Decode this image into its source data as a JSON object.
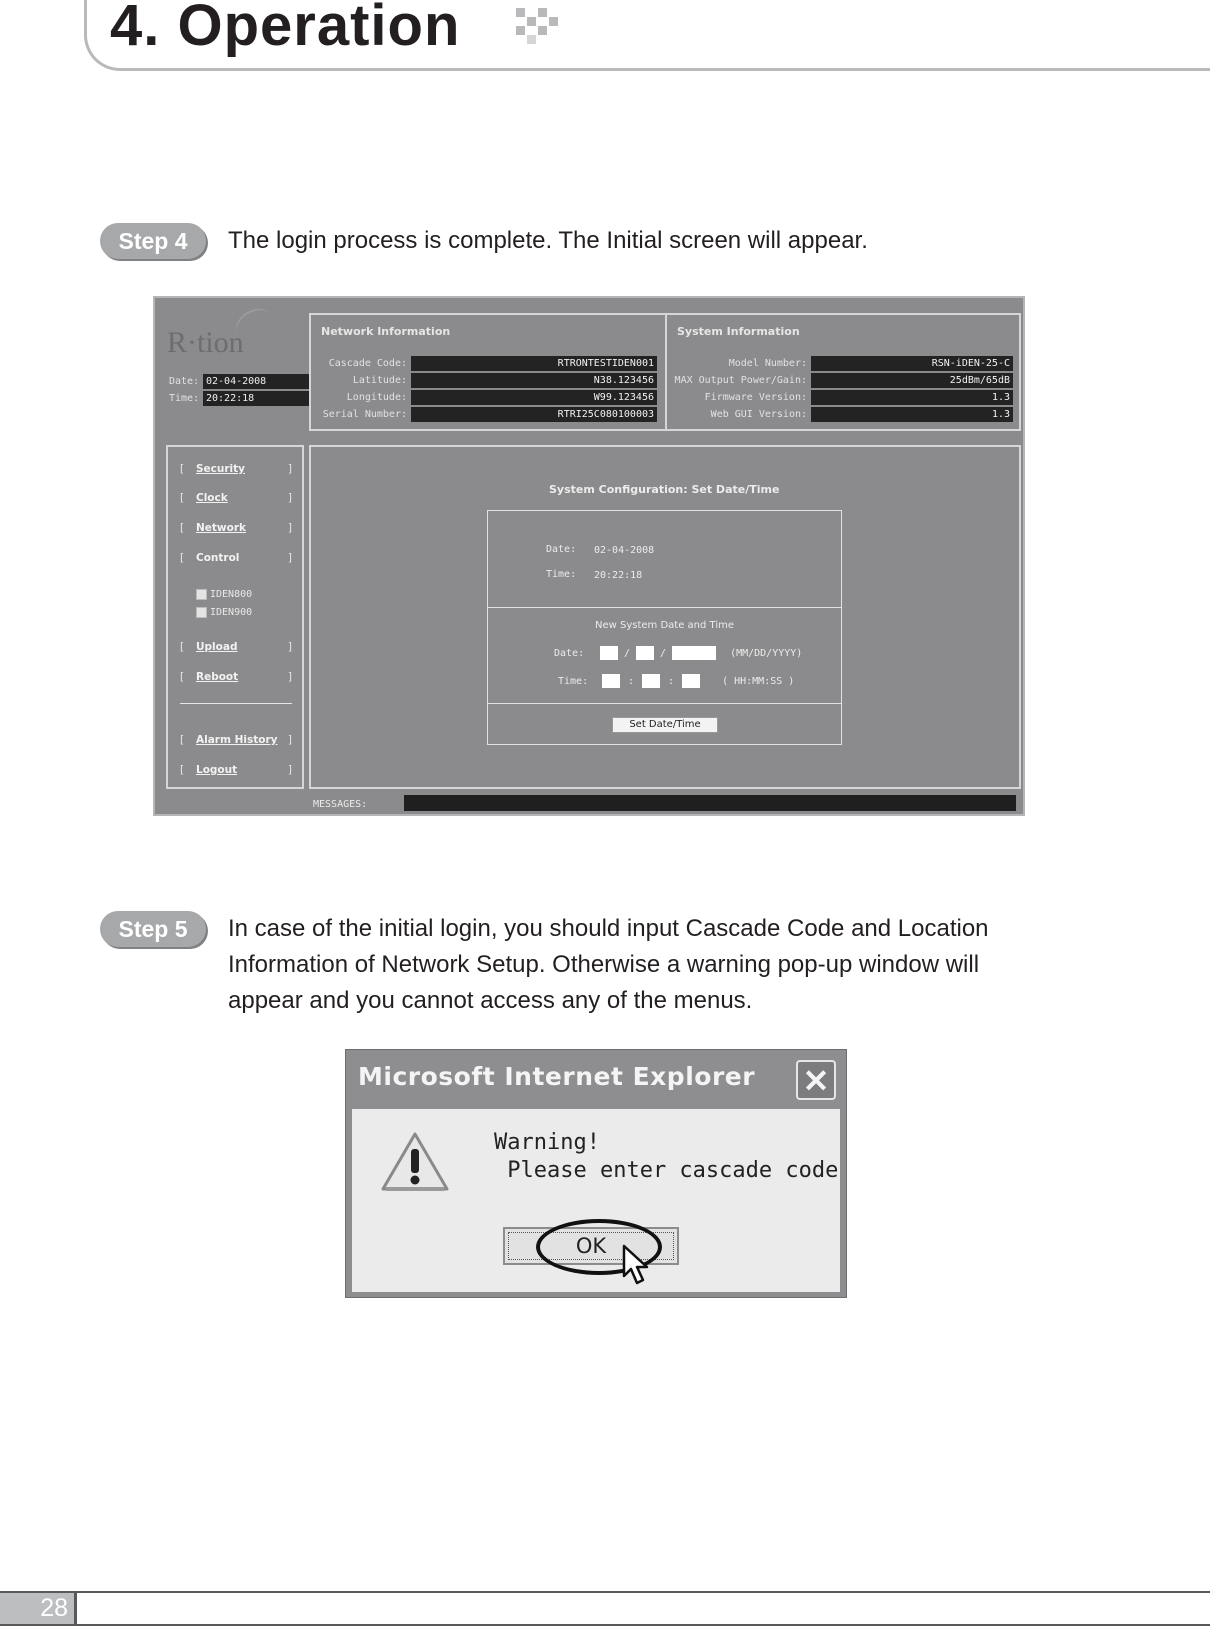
{
  "header": {
    "title": "4. Operation"
  },
  "steps": [
    {
      "badge": "Step 4",
      "text": "The login process is complete. The Initial screen will appear."
    },
    {
      "badge": "Step 5",
      "lines": [
        "In case of the initial login, you should input Cascade Code and Location",
        "Information of Network Setup. Otherwise a warning pop-up window will",
        "appear and you cannot access any of the menus."
      ]
    }
  ],
  "app": {
    "logo": "R·tion",
    "date_label": "Date:",
    "date_value": "02-04-2008",
    "time_label": "Time:",
    "time_value": "20:22:18",
    "network": {
      "title": "Network Information",
      "rows": [
        {
          "label": "Cascade Code:",
          "value": "RTRONTESTIDEN001"
        },
        {
          "label": "Latitude:",
          "value": "N38.123456"
        },
        {
          "label": "Longitude:",
          "value": "W99.123456"
        },
        {
          "label": "Serial Number:",
          "value": "RTRI25C080100003"
        }
      ]
    },
    "system": {
      "title": "System Information",
      "rows": [
        {
          "label": "Model Number:",
          "value": "RSN-iDEN-25-C"
        },
        {
          "label": "MAX Output Power/Gain:",
          "value": "25dBm/65dB"
        },
        {
          "label": "Firmware Version:",
          "value": "1.3"
        },
        {
          "label": "Web GUI Version:",
          "value": "1.3"
        }
      ]
    },
    "nav": {
      "items": [
        {
          "label": "Security"
        },
        {
          "label": "Clock"
        },
        {
          "label": "Network"
        },
        {
          "label": "Control"
        },
        {
          "label": "Upload"
        },
        {
          "label": "Reboot"
        },
        {
          "label": "Alarm History"
        },
        {
          "label": "Logout"
        }
      ],
      "checkboxes": [
        {
          "label": "IDEN800",
          "checked": false
        },
        {
          "label": "IDEN900",
          "checked": false
        }
      ],
      "bracket_l": "[",
      "bracket_r": "]"
    },
    "config": {
      "title": "System Configuration: Set Date/Time",
      "current_date_label": "Date:",
      "current_date": "02-04-2008",
      "current_time_label": "Time:",
      "current_time": "20:22:18",
      "new_title": "New System Date and Time",
      "new_date_label": "Date:",
      "new_time_label": "Time:",
      "date_sep": "/",
      "time_sep": ":",
      "date_format": "(MM/DD/YYYY)",
      "time_format": "( HH:MM:SS )",
      "month": "",
      "day": "",
      "year": "",
      "hour": "",
      "minute": "",
      "second": "",
      "button": "Set Date/Time"
    },
    "messages_label": "MESSAGES:",
    "messages_value": ""
  },
  "dialog": {
    "title": "Microsoft Internet Explorer",
    "close": "✕",
    "line1": "Warning!",
    "line2": " Please enter cascade code",
    "ok": "OK"
  },
  "footer": {
    "page_number": "28"
  }
}
